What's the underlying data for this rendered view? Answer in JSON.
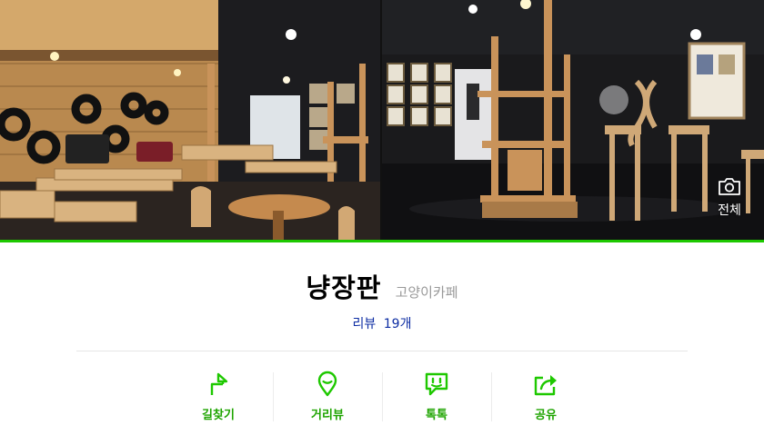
{
  "gallery": {
    "all_photos_label": "전체",
    "all_photos_icon": "camera-icon"
  },
  "place": {
    "name": "냥장판",
    "category": "고양이카페"
  },
  "reviews": {
    "label": "리뷰",
    "count": "19개"
  },
  "actions": [
    {
      "label": "길찾기",
      "icon": "directions-icon"
    },
    {
      "label": "거리뷰",
      "icon": "street-view-pin-icon"
    },
    {
      "label": "톡톡",
      "icon": "chat-icon"
    },
    {
      "label": "공유",
      "icon": "share-icon"
    }
  ],
  "colors": {
    "accent_green": "#1ec800",
    "action_label_green": "#1ea400",
    "review_blue": "#0d2da3",
    "category_gray": "#999999"
  }
}
